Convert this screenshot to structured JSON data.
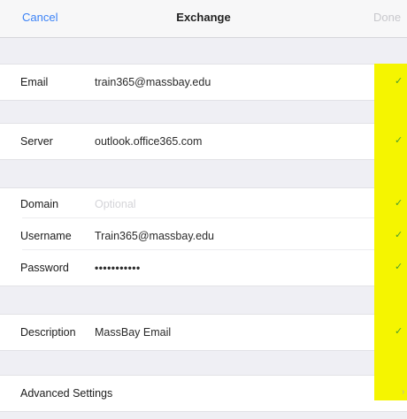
{
  "nav": {
    "cancel": "Cancel",
    "title": "Exchange",
    "done": "Done"
  },
  "fields": {
    "email": {
      "label": "Email",
      "value": "train365@massbay.edu"
    },
    "server": {
      "label": "Server",
      "value": "outlook.office365.com"
    },
    "domain": {
      "label": "Domain",
      "placeholder": "Optional"
    },
    "username": {
      "label": "Username",
      "value": "Train365@massbay.edu"
    },
    "password": {
      "label": "Password",
      "value": "•••••••••••"
    },
    "description": {
      "label": "Description",
      "value": "MassBay Email"
    },
    "advanced": {
      "label": "Advanced Settings"
    }
  },
  "check_glyph": "✓",
  "chevron_glyph": "›",
  "colors": {
    "accent": "#3b82f6",
    "highlight": "#f5f500",
    "check": "#4a9d2e"
  }
}
